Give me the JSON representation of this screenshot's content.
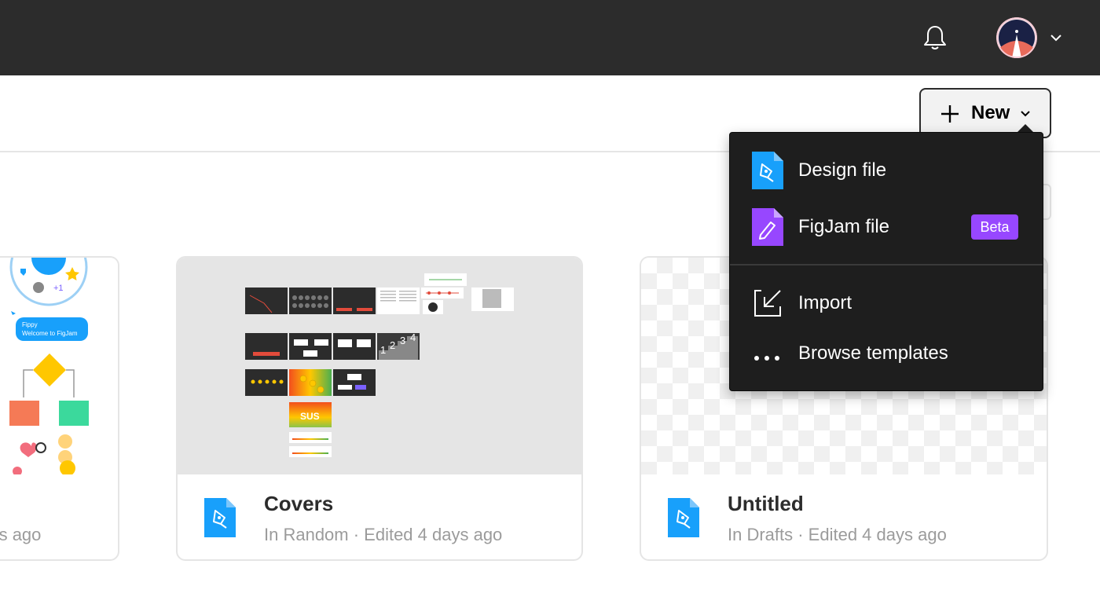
{
  "header": {
    "notifications_icon": "bell-icon",
    "avatar_icon": "rocket-avatar",
    "account_menu_icon": "chevron-down-icon"
  },
  "toolbar": {
    "new_button_label": "New",
    "new_button_icon": "plus-icon"
  },
  "new_menu": {
    "items": [
      {
        "label": "Design file",
        "icon": "design-file-icon",
        "color": "#18a0fb"
      },
      {
        "label": "FigJam file",
        "icon": "figjam-file-icon",
        "color": "#9747ff",
        "badge": "Beta"
      },
      {
        "label": "Import",
        "icon": "import-icon"
      },
      {
        "label": "Browse templates",
        "icon": "more-dots-icon"
      }
    ]
  },
  "files": [
    {
      "title": "",
      "meta": "utes ago",
      "thumbnail": "figjam-welcome-board"
    },
    {
      "title": "Covers",
      "meta": "In Random · Edited 4 days ago",
      "thumbnail": "slides-overview"
    },
    {
      "title": "Untitled",
      "meta": "In Drafts · Edited 4 days ago",
      "thumbnail": "empty-canvas"
    }
  ],
  "thumbnail_text": {
    "figjam_welcome_user": "Fippy",
    "figjam_welcome_message": "Welcome to FigJam",
    "figjam_plus": "+1",
    "covers_steps": [
      "1",
      "2",
      "3",
      "4"
    ],
    "covers_badge": "SUS"
  },
  "colors": {
    "topbar": "#2c2c2c",
    "menu_bg": "#1e1e1e",
    "design_blue": "#18a0fb",
    "figjam_purple": "#9747ff"
  }
}
